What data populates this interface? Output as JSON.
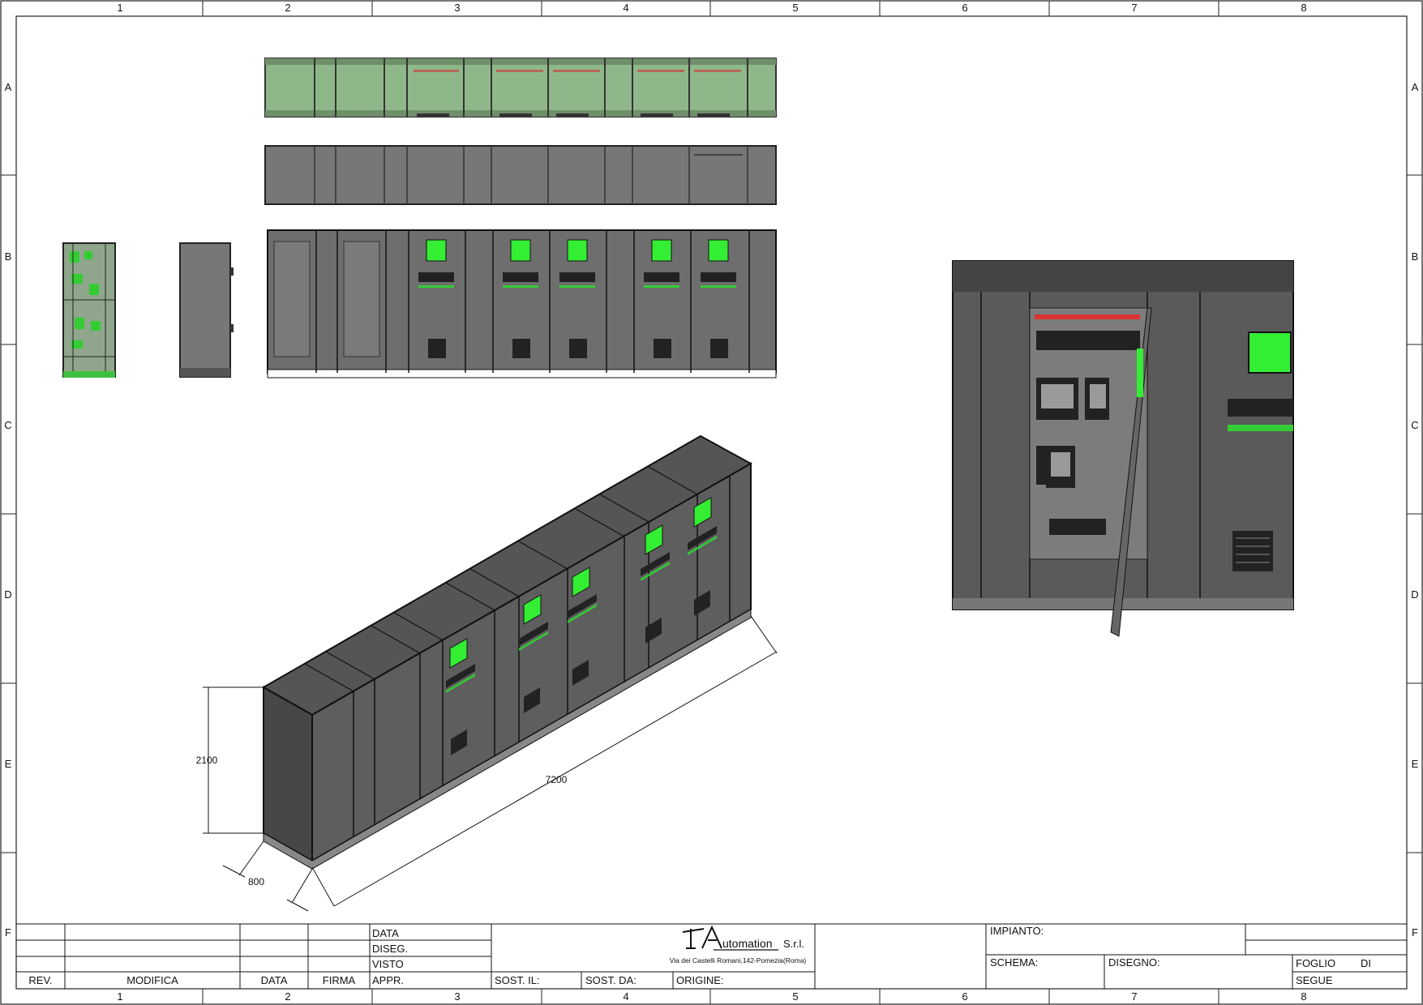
{
  "frame": {
    "columns": [
      "1",
      "2",
      "3",
      "4",
      "5",
      "6",
      "7",
      "8"
    ],
    "rows": [
      "A",
      "B",
      "C",
      "D",
      "E",
      "F"
    ]
  },
  "dimensions": {
    "height": "2100",
    "length": "7200",
    "depth": "800"
  },
  "title_block": {
    "rev": "REV.",
    "modifica": "MODIFICA",
    "data": "DATA",
    "firma": "FIRMA",
    "data_row": "DATA",
    "diseg": "DISEG.",
    "visto": "VISTO",
    "appr": "APPR.",
    "sost_il": "SOST. IL:",
    "sost_da": "SOST. DA:",
    "origine": "ORIGINE:",
    "impianto": "IMPIANTO:",
    "schema": "SCHEMA:",
    "disegno": "DISEGNO:",
    "foglio": "FOGLIO",
    "di": "DI",
    "segue": "SEGUE"
  },
  "company": {
    "logo_text": "Automation S.r.l.",
    "logo_word": "utomation",
    "logo_suffix": "S.r.l.",
    "address": "Via dei Castelli Romani,142-Pomezia(Roma)"
  },
  "colors": {
    "panel_green": "#33ee33",
    "cabinet_gray": "#6e6e6e",
    "cabinet_dark": "#3d3d3d",
    "frame_line": "#222222"
  }
}
